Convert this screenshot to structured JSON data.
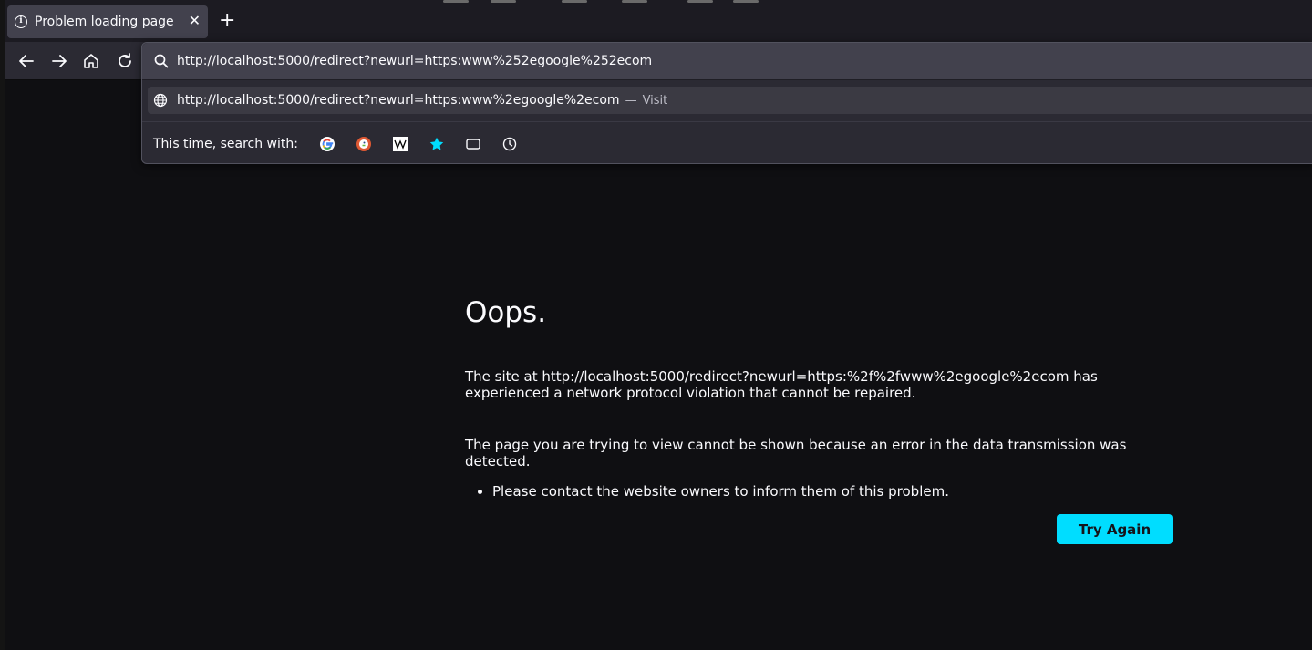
{
  "tab": {
    "title": "Problem loading page",
    "close_glyph": "✕",
    "icon": "info-icon"
  },
  "new_tab_glyph": "+",
  "nav": {
    "back_icon": "back-arrow-icon",
    "forward_icon": "forward-arrow-icon",
    "home_icon": "home-icon",
    "reload_icon": "reload-icon"
  },
  "urlbar": {
    "value": "http://localhost:5000/redirect?newurl=https:www%252egoogle%252ecom"
  },
  "suggestion": {
    "url": "http://localhost:5000/redirect?newurl=https:www%2egoogle%2ecom",
    "separator": "—",
    "action": "Visit"
  },
  "search_with": {
    "label": "This time, search with:",
    "engines": [
      "google-icon",
      "duckduckgo-icon",
      "wikipedia-icon",
      "bookmarks-star-icon",
      "tabs-icon",
      "history-icon"
    ]
  },
  "error": {
    "title": "Oops.",
    "paragraph1": "The site at http://localhost:5000/redirect?newurl=https:%2f%2fwww%2egoogle%2ecom has experienced a network protocol violation that cannot be repaired.",
    "paragraph2": "The page you are trying to view cannot be shown because an error in the data transmission was detected.",
    "bullets": [
      "Please contact the website owners to inform them of this problem."
    ],
    "button": "Try Again"
  },
  "colors": {
    "accent": "#00ddff",
    "background": "#1c1b22",
    "toolbar": "#2b2a33",
    "text": "#fbfbfe"
  }
}
